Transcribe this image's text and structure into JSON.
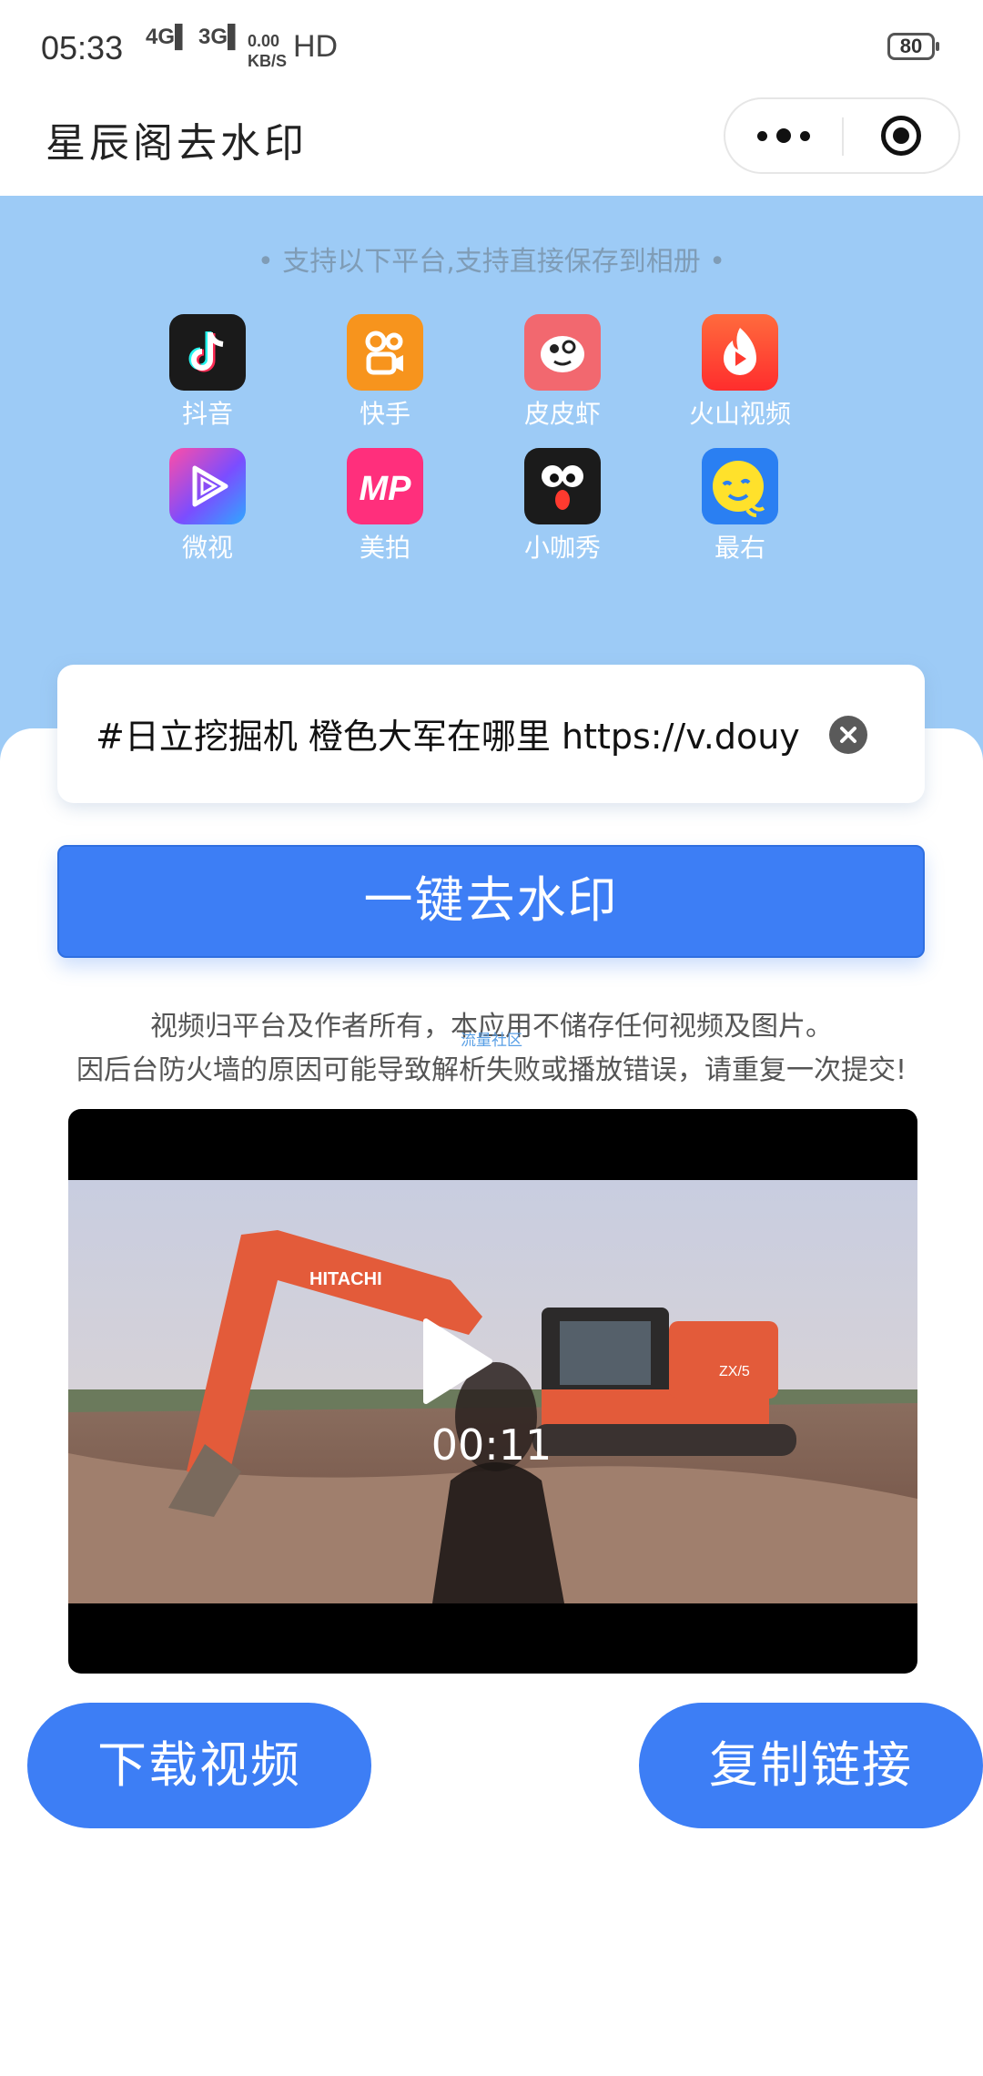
{
  "status_bar": {
    "time": "05:33",
    "signal1": "4G",
    "signal2": "3G",
    "speed_top": "0.00",
    "speed_unit": "KB/S",
    "hd": "HD",
    "battery": "80"
  },
  "header": {
    "title": "星辰阁去水印"
  },
  "panel": {
    "subtitle": "• 支持以下平台,支持直接保存到相册 •",
    "platforms": [
      {
        "label": "抖音",
        "icon": "douyin-icon",
        "color": "#1a1a1a"
      },
      {
        "label": "快手",
        "icon": "kuaishou-icon",
        "color": "#f7941d"
      },
      {
        "label": "皮皮虾",
        "icon": "pipixia-icon",
        "color": "#f2686f"
      },
      {
        "label": "火山视频",
        "icon": "huoshan-icon",
        "color": "#ff3a2f"
      },
      {
        "label": "微视",
        "icon": "weishi-icon",
        "color": "#7b4dff"
      },
      {
        "label": "美拍",
        "icon": "meipai-icon",
        "color": "#ff2f7c"
      },
      {
        "label": "小咖秀",
        "icon": "xiaokaxiu-icon",
        "color": "#1b1b1b"
      },
      {
        "label": "最右",
        "icon": "zuiyou-icon",
        "color": "#2a7ff2"
      }
    ]
  },
  "input": {
    "value": "#日立挖掘机 橙色大军在哪里 https://v.douy"
  },
  "actions": {
    "remove_watermark": "一键去水印",
    "download": "下载视频",
    "copy_link": "复制链接"
  },
  "notice": {
    "line1": "视频归平台及作者所有，本应用不储存任何视频及图片。",
    "line2": "因后台防火墙的原因可能导致解析失败或播放错误，请重复一次提交!"
  },
  "video": {
    "duration": "00:11",
    "watermark": "流量社区",
    "brand": "HITACHI",
    "model": "ZX/5"
  }
}
